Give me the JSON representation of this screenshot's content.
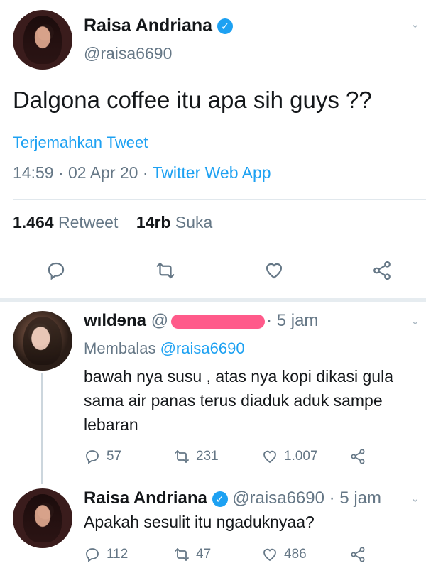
{
  "main": {
    "name": "Raisa Andriana",
    "handle": "@raisa6690",
    "text": "Dalgona coffee itu apa sih guys ??",
    "translate": "Terjemahkan Tweet",
    "time": "14:59 · 02 Apr 20 · ",
    "source": "Twitter Web App",
    "retweets": "1.464",
    "retweet_label": "Retweet",
    "likes": "14rb",
    "likes_label": "Suka"
  },
  "replies": [
    {
      "name": "wıldɘna",
      "handle_prefix": "@",
      "time": "· 5 jam",
      "replying": "Membalas ",
      "replying_handle": "@raisa6690",
      "text": "bawah nya susu , atas nya kopi dikasi gula sama air panas terus diaduk aduk sampe lebaran",
      "replies_count": "57",
      "retweets_count": "231",
      "likes_count": "1.007"
    },
    {
      "name": "Raisa Andriana",
      "handle": "@raisa6690",
      "time": "· 5 jam",
      "text": "Apakah sesulit itu ngaduknyaa?",
      "replies_count": "112",
      "retweets_count": "47",
      "likes_count": "486"
    }
  ],
  "icons": {
    "verified": "✓",
    "chevron": "⌄"
  },
  "colors": {
    "accent": "#1da1f2",
    "muted": "#657786",
    "redaction": "#ff5a8a"
  }
}
